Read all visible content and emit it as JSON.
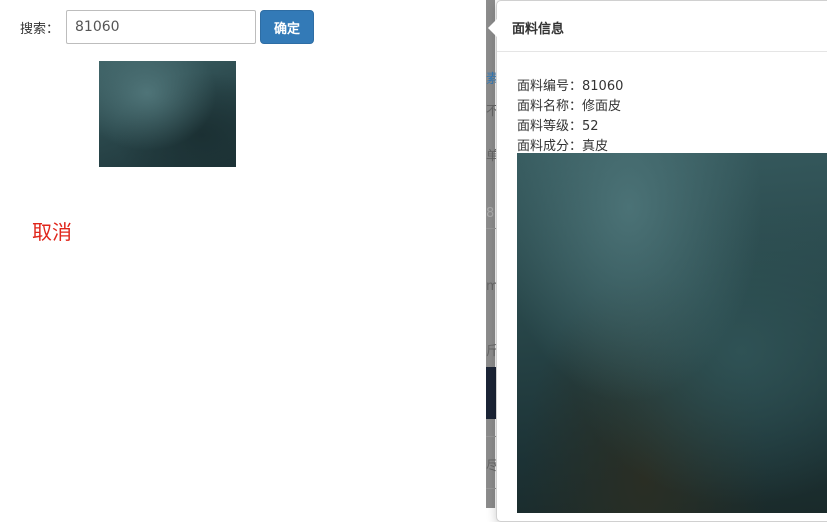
{
  "search": {
    "label": "搜索：",
    "value": "81060",
    "confirm_label": "确定"
  },
  "cancel_label": "取消",
  "background_fragments": [
    "素",
    "不",
    "单",
    "8",
    "m",
    "斤",
    "尽"
  ],
  "popover": {
    "title": "面料信息",
    "lines": [
      "面料编号：81060",
      "面料名称：修面皮",
      "面料等级：52",
      "面料成分：真皮"
    ]
  },
  "colors": {
    "primary_button": "#337ab7",
    "cancel_text": "#e0261b"
  }
}
